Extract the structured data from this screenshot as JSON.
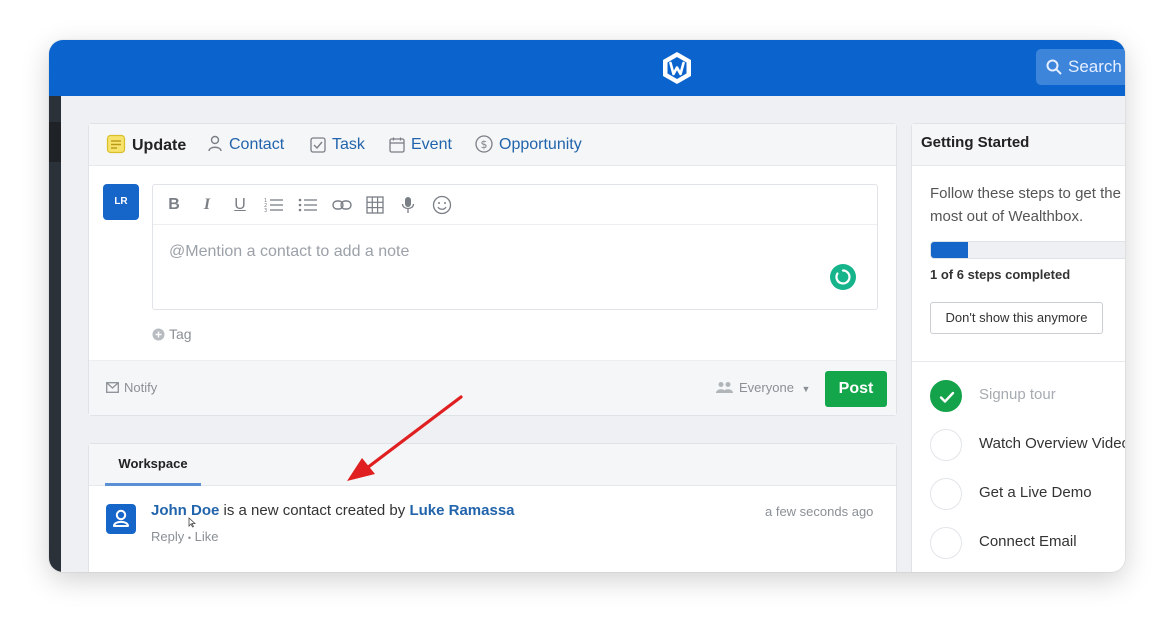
{
  "header": {
    "logo": "wealthbox-logo",
    "search_placeholder": "Search"
  },
  "composer": {
    "tabs": [
      {
        "label": "Update",
        "icon": "note-icon",
        "active": true
      },
      {
        "label": "Contact",
        "icon": "person-icon"
      },
      {
        "label": "Task",
        "icon": "checkbox-icon"
      },
      {
        "label": "Event",
        "icon": "calendar-icon"
      },
      {
        "label": "Opportunity",
        "icon": "dollar-icon"
      }
    ],
    "avatar_initials": "LR",
    "toolbar": [
      "bold-icon",
      "italic-icon",
      "underline-icon",
      "numbered-list-icon",
      "bullet-list-icon",
      "link-icon",
      "table-icon",
      "microphone-icon",
      "emoji-icon"
    ],
    "placeholder": "@Mention a contact to add a note",
    "tag_label": "Tag",
    "notify_label": "Notify",
    "visibility_label": "Everyone",
    "post_label": "Post"
  },
  "workspace": {
    "tab_label": "Workspace",
    "activity": {
      "contact_name": "John Doe",
      "text": " is a new contact created by ",
      "creator": "Luke Ramassa",
      "time": "a few seconds ago",
      "reply_label": "Reply",
      "separator": "•",
      "like_label": "Like"
    }
  },
  "getting_started": {
    "title": "Getting Started",
    "intro": "Follow these steps to get the most out of Wealthbox.",
    "progress_fraction": 0.1667,
    "progress_label": "1 of 6 steps completed",
    "dismiss_label": "Don't show this anymore",
    "steps": [
      {
        "label": "Signup tour",
        "done": true
      },
      {
        "label": "Watch Overview Video",
        "done": false
      },
      {
        "label": "Get a Live Demo",
        "done": false
      },
      {
        "label": "Connect Email",
        "done": false
      }
    ]
  },
  "colors": {
    "brand": "#0b63ce",
    "post_green": "#13a64a",
    "link": "#2264ab",
    "annotation_arrow": "#e02020"
  }
}
